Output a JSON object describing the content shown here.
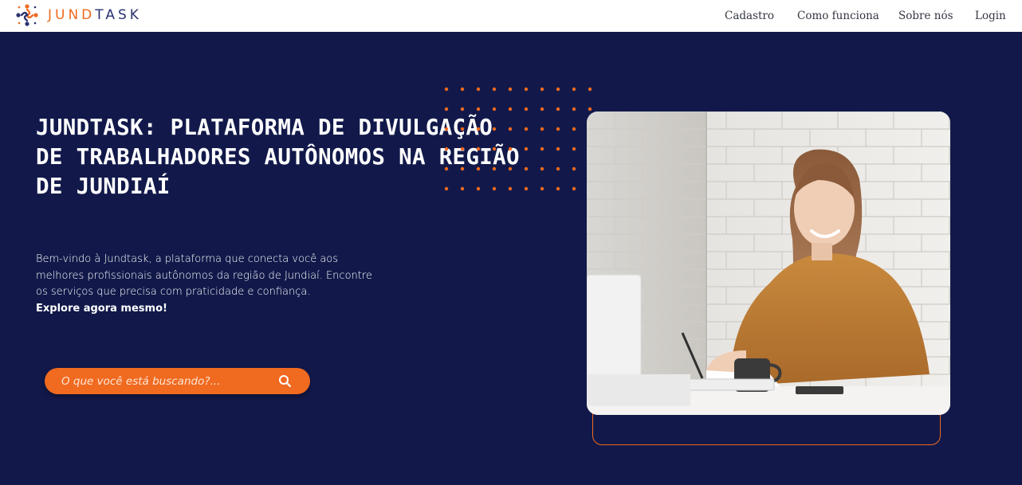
{
  "brand": {
    "name_part1": "JUND",
    "name_part2": "TASK",
    "logo_icon": "people-network-icon",
    "accent_color": "#f06a20",
    "navy_color": "#2a3270"
  },
  "nav": {
    "items": [
      {
        "label": "Cadastro"
      },
      {
        "label": "Como funciona"
      },
      {
        "label": "Sobre nós"
      },
      {
        "label": "Login"
      }
    ]
  },
  "hero": {
    "title": "JUNDTASK: PLATAFORMA DE DIVULGAÇÃO DE TRABALHADORES AUTÔNOMOS NA REGIÃO DE JUNDIAÍ",
    "description": "Bem-vindo à Jundtask, a plataforma que conecta você aos melhores profissionais autônomos da região de Jundiaí. Encontre os serviços que precisa com praticidade e confiança.",
    "cta": "Explore agora mesmo!",
    "background_color": "#12194a"
  },
  "search": {
    "placeholder": "O que você está buscando?...",
    "value": "",
    "icon": "search-icon"
  },
  "image": {
    "subject": "woman-writing-at-desk-photo"
  }
}
